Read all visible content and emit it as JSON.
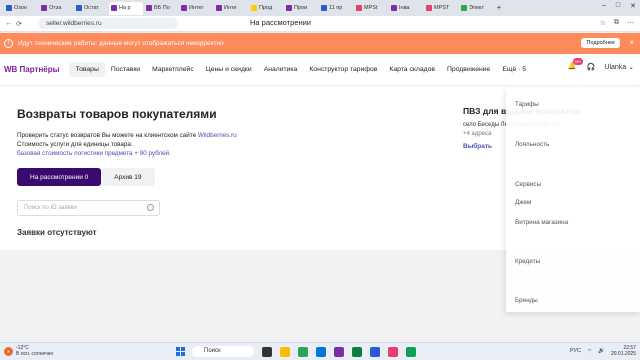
{
  "browser": {
    "tabs": [
      {
        "label": "Озон",
        "color": "#2a5bd7"
      },
      {
        "label": "Отза",
        "color": "#7b2fa5"
      },
      {
        "label": "Остат",
        "color": "#2a5bd7"
      },
      {
        "label": "На р",
        "color": "#7b2fa5",
        "active": true
      },
      {
        "label": "ВБ По",
        "color": "#7b2fa5"
      },
      {
        "label": "Интег",
        "color": "#7b2fa5"
      },
      {
        "label": "Инте",
        "color": "#7b2fa5"
      },
      {
        "label": "Прод",
        "color": "#ffcc00"
      },
      {
        "label": "Прои",
        "color": "#7b2fa5"
      },
      {
        "label": "11 пр",
        "color": "#2a5bd7"
      },
      {
        "label": "MPSt",
        "color": "#e83e6c"
      },
      {
        "label": "Інва",
        "color": "#7b2fa5"
      },
      {
        "label": "MPST",
        "color": "#e83e6c"
      },
      {
        "label": "Элект",
        "color": "#2aa55a"
      }
    ],
    "url": "seller.wildberries.ru",
    "page_title": "На рассмотрении"
  },
  "banner": {
    "text": "Идут технические работы: данные могут отображаться некорректно",
    "more_label": "Подробнее",
    "close_icon": "×"
  },
  "header": {
    "logo": "WB Партнёры",
    "menu": [
      "Товары",
      "Поставки",
      "Маркетплейс",
      "Цены и скидки",
      "Аналитика",
      "Конструктор тарифов",
      "Карта складов",
      "Продвижение",
      "Ещё · 5"
    ],
    "active_menu": "Товары",
    "bell_badge": "99+",
    "user": "Ulanka"
  },
  "main": {
    "title": "Возвраты товаров покупателями",
    "check_status_text": "Проверить статус возвратов Вы можете на клиентском сайте ",
    "check_status_link": "Wildberries.ru",
    "cost_text": "Стоимость услуги для единицы товара:",
    "cost_link": "базовая стоимость логистики предмета + 90 рублей.",
    "tabs": [
      {
        "label": "На рассмотрении 0",
        "active": true
      },
      {
        "label": "Архив 19",
        "active": false
      }
    ],
    "search_placeholder": "Поиск по ID заявки",
    "empty_text": "Заявки отсутствуют"
  },
  "pvz": {
    "title": "ПВЗ для выдачи возвратов",
    "address": "село Беседы Ленинская Улица 2/1",
    "more": "+4 адреса",
    "choose": "Выбрать"
  },
  "dropdown": {
    "items": [
      {
        "label": "Тарифы",
        "type": "item"
      },
      {
        "label": "Лояльность",
        "type": "item"
      },
      {
        "label": "Сервисы",
        "type": "item"
      },
      {
        "label": "Джем",
        "type": "item"
      },
      {
        "label": "Витрина магазина",
        "type": "item"
      },
      {
        "label": "Кредиты",
        "type": "item"
      },
      {
        "label": "Бренды",
        "type": "item"
      }
    ]
  },
  "taskbar": {
    "temp": "-12°C",
    "weather": "В осн. солнечно",
    "search": "Поиск",
    "lang": "РУС",
    "time": "22:57",
    "date": "20.01.2025"
  }
}
